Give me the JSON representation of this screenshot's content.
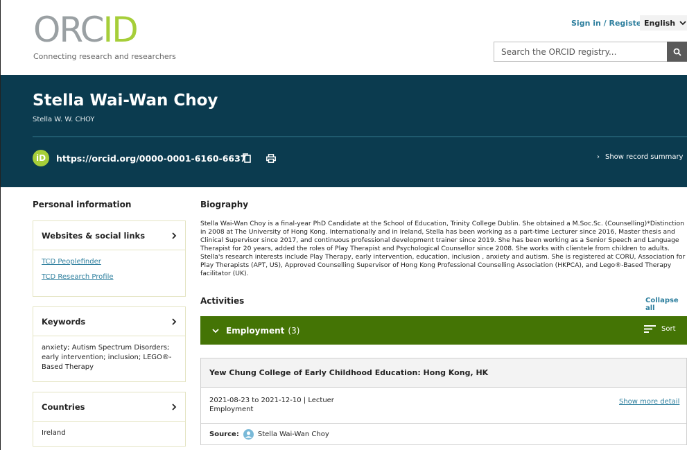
{
  "header": {
    "logo_part1": "ORC",
    "logo_part2": "ID",
    "tagline": "Connecting research and researchers",
    "signin_label": "Sign in / Register",
    "language": "English",
    "search_placeholder": "Search the ORCID registry..."
  },
  "profile": {
    "name": "Stella Wai-Wan Choy",
    "alt_name": "Stella W. W. CHOY",
    "orcid_badge": "iD",
    "orcid_url": "https://orcid.org/0000-0001-6160-6637",
    "summary_label": "Show record summary"
  },
  "sidebar": {
    "title": "Personal information",
    "websites": {
      "title": "Websites & social links",
      "links": [
        "TCD Peoplefinder",
        "TCD Research Profile"
      ]
    },
    "keywords": {
      "title": "Keywords",
      "text": "anxiety; Autism Spectrum Disorders; early intervention; inclusion; LEGO®-Based Therapy"
    },
    "countries": {
      "title": "Countries",
      "text": "Ireland"
    }
  },
  "biography": {
    "title": "Biography",
    "text": "Stella Wai-Wan Choy is a final-year PhD Candidate at the School of Education, Trinity College Dublin. She obtained a M.Soc.Sc. (Counselling)*Distinction in 2008 at The University of Hong Kong. Internationally and in Ireland, Stella has been working as a part-time Lecturer since 2016, Master thesis and Clinical Supervisor since 2017, and continuous professional development trainer since 2019. She has been working as a Senior Speech and Language Therapist for 20 years, added the roles of Play Therapist and Psychological Counsellor since 2008. She works with clientele from children to adults. Stella's research interests include Play Therapy, early intervention, education, inclusion , anxiety and autism. She is registered at CORU, Association for Play Therapists (APT, US), Approved Counselling Supervisor of Hong Kong Professional Counselling Association (HKPCA), and Lego®-Based Therapy facilitator (UK)."
  },
  "activities": {
    "title": "Activities",
    "collapse_label": "Collapse all",
    "employment": {
      "title": "Employment",
      "count": "(3)",
      "sort_label": "Sort",
      "item": {
        "org": "Yew Chung College of Early Childhood Education: Hong Kong, HK",
        "dates_role": "2021-08-23 to 2021-12-10 | Lectuer",
        "type": "Employment",
        "show_more": "Show more detail",
        "source_label": "Source:",
        "source_name": "Stella Wai-Wan Choy"
      }
    }
  },
  "colors": {
    "banner": "#0b3b4f",
    "accent_green": "#a6ce39",
    "employment_bar": "#447405",
    "link": "#2e7f9e"
  }
}
